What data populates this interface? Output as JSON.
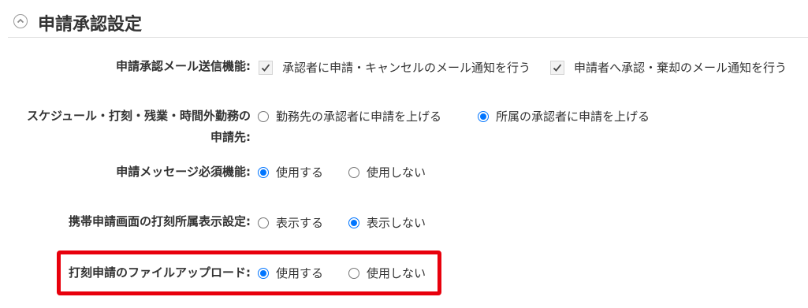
{
  "section": {
    "title": "申請承認設定",
    "collapse_icon": "chevron-up-icon"
  },
  "rows": [
    {
      "label": "申請承認メール送信機能:",
      "type": "checkbox",
      "options": [
        {
          "label": "承認者に申請・キャンセルのメール通知を行う",
          "checked": true
        },
        {
          "label": "申請者へ承認・棄却のメール通知を行う",
          "checked": true
        }
      ]
    },
    {
      "label_line1": "スケジュール・打刻・残業・時間外勤務の",
      "label_line2": "申請先:",
      "type": "radio",
      "options": [
        {
          "label": "勤務先の承認者に申請を上げる",
          "checked": false
        },
        {
          "label": "所属の承認者に申請を上げる",
          "checked": true
        }
      ]
    },
    {
      "label": "申請メッセージ必須機能:",
      "type": "radio",
      "options": [
        {
          "label": "使用する",
          "checked": true
        },
        {
          "label": "使用しない",
          "checked": false
        }
      ]
    },
    {
      "label": "携帯申請画面の打刻所属表示設定:",
      "type": "radio",
      "options": [
        {
          "label": "表示する",
          "checked": false
        },
        {
          "label": "表示しない",
          "checked": true
        }
      ]
    },
    {
      "label": "打刻申請のファイルアップロード:",
      "type": "radio",
      "highlighted": true,
      "options": [
        {
          "label": "使用する",
          "checked": true
        },
        {
          "label": "使用しない",
          "checked": false
        }
      ]
    }
  ],
  "colors": {
    "accent": "#0075ff",
    "highlight": "#e8000c",
    "text": "#333333"
  }
}
